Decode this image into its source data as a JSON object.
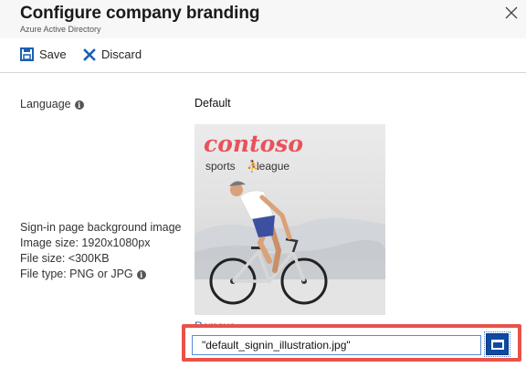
{
  "header": {
    "title": "Configure company branding",
    "subtitle": "Azure Active Directory"
  },
  "toolbar": {
    "save_label": "Save",
    "discard_label": "Discard"
  },
  "fields": {
    "language_label": "Language",
    "language_value": "Default",
    "bg_image": {
      "label": "Sign-in page background image",
      "size": "Image size: 1920x1080px",
      "file_size": "File size: <300KB",
      "file_type": "File type: PNG or JPG",
      "logo_brand": "contoso",
      "logo_sports": "sports",
      "logo_league": "league",
      "remove_label": "Remove",
      "file_value": "\"default_signin_illustration.jpg\""
    }
  },
  "colors": {
    "highlight": "#e8524a",
    "accent": "#0067b8",
    "brand_logo": "#e8525b"
  },
  "icons": {
    "close": "close-icon",
    "save": "save-icon",
    "discard": "discard-icon",
    "info": "info-icon",
    "browse": "folder-icon"
  }
}
